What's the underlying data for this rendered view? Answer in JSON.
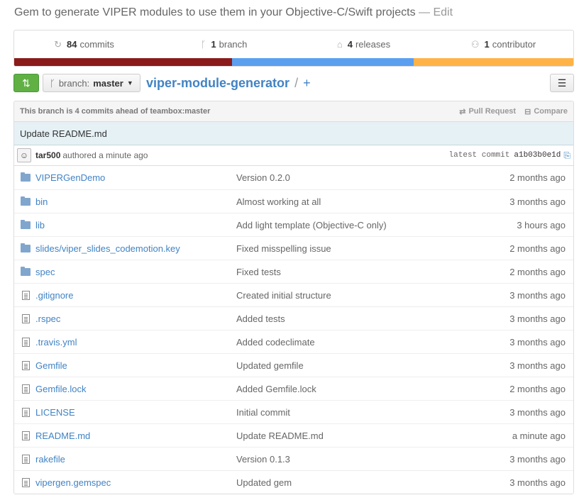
{
  "repo": {
    "description": "Gem to generate VIPER modules to use them in your Objective-C/Swift projects",
    "edit_label": "— Edit",
    "name": "viper-module-generator",
    "path_sep": "/",
    "plus": "+"
  },
  "stats": {
    "commits_count": "84",
    "commits_label": "commits",
    "branch_count": "1",
    "branch_label": "branch",
    "releases_count": "4",
    "releases_label": "releases",
    "contributor_count": "1",
    "contributor_label": "contributor"
  },
  "language_bar": [
    {
      "color": "#8b1a1a",
      "fraction": 0.39
    },
    {
      "color": "#5b9ff0",
      "fraction": 0.325
    },
    {
      "color": "#ffb347",
      "fraction": 0.285
    }
  ],
  "branch_selector": {
    "prefix": "branch:",
    "value": "master"
  },
  "ahead_bar": {
    "text": "This branch is 4 commits ahead of teambox:master",
    "pull_request": "Pull Request",
    "compare": "Compare"
  },
  "latest_commit": {
    "message": "Update README.md",
    "author": "tar500",
    "authored": "authored a minute ago",
    "sha_label": "latest commit",
    "sha": "a1b03b0e1d"
  },
  "files": [
    {
      "type": "dir",
      "name": "VIPERGenDemo",
      "message": "Version 0.2.0",
      "age": "2 months ago"
    },
    {
      "type": "dir",
      "name": "bin",
      "message": "Almost working at all",
      "age": "3 months ago"
    },
    {
      "type": "dir",
      "name": "lib",
      "message": "Add light template (Objective-C only)",
      "age": "3 hours ago"
    },
    {
      "type": "dir",
      "name": "slides/viper_slides_codemotion.key",
      "message": "Fixed misspelling issue",
      "age": "2 months ago"
    },
    {
      "type": "dir",
      "name": "spec",
      "message": "Fixed tests",
      "age": "2 months ago"
    },
    {
      "type": "file",
      "name": ".gitignore",
      "message": "Created initial structure",
      "age": "3 months ago"
    },
    {
      "type": "file",
      "name": ".rspec",
      "message": "Added tests",
      "age": "3 months ago"
    },
    {
      "type": "file",
      "name": ".travis.yml",
      "message": "Added codeclimate",
      "age": "3 months ago"
    },
    {
      "type": "file",
      "name": "Gemfile",
      "message": "Updated gemfile",
      "age": "3 months ago"
    },
    {
      "type": "file",
      "name": "Gemfile.lock",
      "message": "Added Gemfile.lock",
      "age": "2 months ago"
    },
    {
      "type": "file",
      "name": "LICENSE",
      "message": "Initial commit",
      "age": "3 months ago"
    },
    {
      "type": "file",
      "name": "README.md",
      "message": "Update README.md",
      "age": "a minute ago"
    },
    {
      "type": "file",
      "name": "rakefile",
      "message": "Version 0.1.3",
      "age": "3 months ago"
    },
    {
      "type": "file",
      "name": "vipergen.gemspec",
      "message": "Updated gem",
      "age": "3 months ago"
    }
  ]
}
